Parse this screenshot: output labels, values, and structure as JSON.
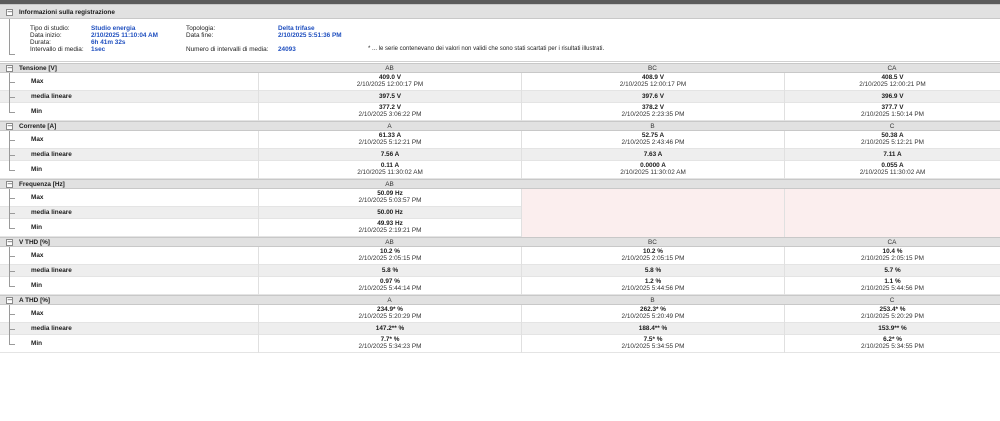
{
  "info": {
    "title": "Informazioni sulla registrazione",
    "study_type_label": "Tipo di studio:",
    "study_type": "Studio energia",
    "start_label": "Data inizio:",
    "start": "2/10/2025 11:10:04 AM",
    "duration_label": "Durata:",
    "duration": "6h 41m 32s",
    "interval_label": "Intervallo di media:",
    "interval": "1sec",
    "topology_label": "Topologia:",
    "topology": "Delta trifase",
    "end_label": "Data fine:",
    "end": "2/10/2025 5:51:36 PM",
    "count_label": "Numero di intervalli di media:",
    "count": "24093",
    "note": "* ... le serie contenevano dei valori non validi che sono stati scartati per i risultati illustrati."
  },
  "row_labels": {
    "max": "Max",
    "avg": "media lineare",
    "min": "Min"
  },
  "sections": [
    {
      "title": "Tensione [V]",
      "columns": [
        "AB",
        "BC",
        "CA"
      ],
      "max": [
        {
          "v": "409.0 V",
          "t": "2/10/2025 12:00:17 PM"
        },
        {
          "v": "408.9 V",
          "t": "2/10/2025 12:00:17 PM"
        },
        {
          "v": "408.5 V",
          "t": "2/10/2025 12:00:21 PM"
        }
      ],
      "avg": [
        "397.5 V",
        "397.6 V",
        "396.9 V"
      ],
      "min": [
        {
          "v": "377.2 V",
          "t": "2/10/2025 3:06:22 PM"
        },
        {
          "v": "378.2 V",
          "t": "2/10/2025 2:23:35 PM"
        },
        {
          "v": "377.7 V",
          "t": "2/10/2025 1:50:14 PM"
        }
      ]
    },
    {
      "title": "Corrente [A]",
      "columns": [
        "A",
        "B",
        "C"
      ],
      "max": [
        {
          "v": "61.33 A",
          "t": "2/10/2025 5:12:21 PM"
        },
        {
          "v": "52.75 A",
          "t": "2/10/2025 2:43:46 PM"
        },
        {
          "v": "50.38 A",
          "t": "2/10/2025 5:12:21 PM"
        }
      ],
      "avg": [
        "7.56 A",
        "7.63 A",
        "7.11 A"
      ],
      "min": [
        {
          "v": "0.11 A",
          "t": "2/10/2025 11:30:02 AM"
        },
        {
          "v": "0.0000 A",
          "t": "2/10/2025 11:30:02 AM"
        },
        {
          "v": "0.055 A",
          "t": "2/10/2025 11:30:02 AM"
        }
      ]
    },
    {
      "title": "Frequenza [Hz]",
      "columns": [
        "AB"
      ],
      "max": [
        {
          "v": "50.09 Hz",
          "t": "2/10/2025 5:03:57 PM"
        }
      ],
      "avg": [
        "50.00 Hz"
      ],
      "min": [
        {
          "v": "49.93 Hz",
          "t": "2/10/2025 2:19:21 PM"
        }
      ]
    },
    {
      "title": "V THD [%]",
      "columns": [
        "AB",
        "BC",
        "CA"
      ],
      "max": [
        {
          "v": "10.2 %",
          "t": "2/10/2025 2:05:15 PM"
        },
        {
          "v": "10.2 %",
          "t": "2/10/2025 2:05:15 PM"
        },
        {
          "v": "10.4 %",
          "t": "2/10/2025 2:05:15 PM"
        }
      ],
      "avg": [
        "5.8 %",
        "5.8 %",
        "5.7 %"
      ],
      "min": [
        {
          "v": "0.97 %",
          "t": "2/10/2025 5:44:14 PM"
        },
        {
          "v": "1.2 %",
          "t": "2/10/2025 5:44:56 PM"
        },
        {
          "v": "1.1 %",
          "t": "2/10/2025 5:44:56 PM"
        }
      ]
    },
    {
      "title": "A THD [%]",
      "columns": [
        "A",
        "B",
        "C"
      ],
      "max": [
        {
          "v": "234.9* %",
          "t": "2/10/2025 5:20:29 PM"
        },
        {
          "v": "262.3* %",
          "t": "2/10/2025 5:20:49 PM"
        },
        {
          "v": "253.4* %",
          "t": "2/10/2025 5:20:29 PM"
        }
      ],
      "avg": [
        "147.2** %",
        "188.4** %",
        "153.9** %"
      ],
      "min": [
        {
          "v": "7.7* %",
          "t": "2/10/2025 5:34:23 PM"
        },
        {
          "v": "7.5* %",
          "t": "2/10/2025 5:34:55 PM"
        },
        {
          "v": "6.2* %",
          "t": "2/10/2025 5:34:55 PM"
        }
      ]
    }
  ]
}
